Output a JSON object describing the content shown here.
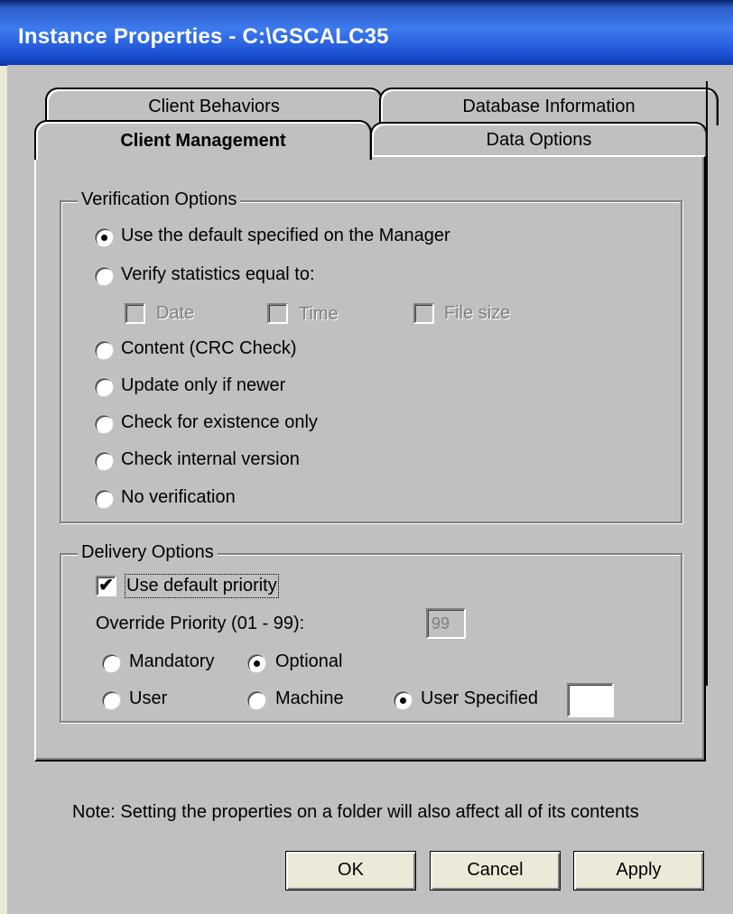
{
  "window": {
    "title": "Instance Properties - C:\\GSCALC35"
  },
  "tabs": {
    "back_row": [
      "Client Behaviors",
      "Database Information"
    ],
    "front_row": [
      "Client Management",
      "Data Options"
    ],
    "active": "Client Management"
  },
  "verification": {
    "legend": "Verification Options",
    "options": [
      "Use the default specified on the Manager",
      "Verify statistics equal to:",
      "Content (CRC Check)",
      "Update only if newer",
      "Check for existence only",
      "Check internal version",
      "No verification"
    ],
    "selected_index": 0,
    "stat_checks": [
      "Date",
      "Time",
      "File size"
    ]
  },
  "delivery": {
    "legend": "Delivery Options",
    "use_default_priority_label": "Use default priority",
    "use_default_priority_checked": true,
    "override_label": "Override Priority (01 - 99):",
    "override_value": "99",
    "mandatory_label": "Mandatory",
    "optional_label": "Optional",
    "priority_selected": "Optional",
    "user_label": "User",
    "machine_label": "Machine",
    "user_specified_label": "User Specified",
    "scope_selected": "User Specified",
    "user_specified_value": ""
  },
  "note": "Note: Setting the properties on a folder will also affect all of its contents",
  "buttons": {
    "ok": "OK",
    "cancel": "Cancel",
    "apply": "Apply"
  }
}
